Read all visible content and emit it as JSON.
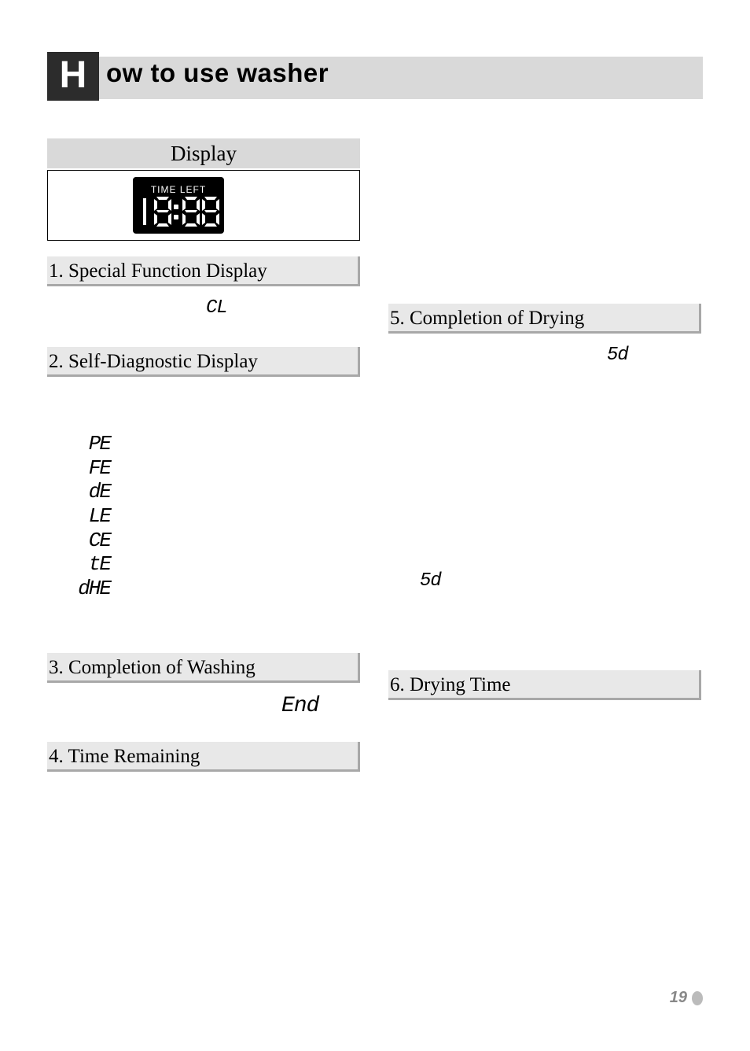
{
  "header": {
    "drop_cap": "H",
    "title_rest": "ow to use washer"
  },
  "display_section": {
    "heading": "Display",
    "lcd_label": "TIME LEFT",
    "lcd_value": "18:88"
  },
  "left_sections": {
    "s1": {
      "heading": "1. Special Function Display",
      "row_label": "",
      "row_code": "CL"
    },
    "s2": {
      "heading": "2. Self-Diagnostic Display",
      "codes": [
        {
          "code": "PE",
          "text": ""
        },
        {
          "code": "FE",
          "text": ""
        },
        {
          "code": "dE",
          "text": ""
        },
        {
          "code": "LE",
          "text": ""
        },
        {
          "code": "CE",
          "text": ""
        },
        {
          "code": "tE",
          "text": ""
        },
        {
          "code": "dHE",
          "text": ""
        }
      ]
    },
    "s3": {
      "heading": "3. Completion of Washing",
      "row_label": "",
      "row_code": "End"
    },
    "s4": {
      "heading": "4. Time Remaining"
    }
  },
  "right_sections": {
    "s5": {
      "heading": "5. Completion of Drying",
      "code_line": "5d",
      "para_before": "",
      "para_code": "5d",
      "para_after": ""
    },
    "s6": {
      "heading": "6. Drying Time"
    }
  },
  "page_number": "19"
}
